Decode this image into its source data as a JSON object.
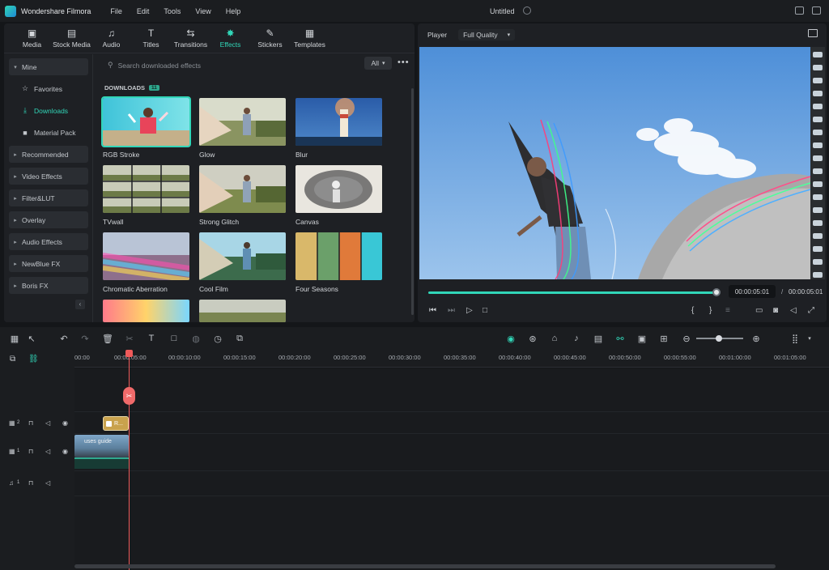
{
  "app": {
    "name": "Wondershare Filmora",
    "doc_title": "Untitled"
  },
  "menu": [
    "File",
    "Edit",
    "Tools",
    "View",
    "Help"
  ],
  "toolbar": [
    {
      "label": "Media",
      "icon": "media-icon"
    },
    {
      "label": "Stock Media",
      "icon": "stock-media-icon"
    },
    {
      "label": "Audio",
      "icon": "audio-icon"
    },
    {
      "label": "Titles",
      "icon": "titles-icon"
    },
    {
      "label": "Transitions",
      "icon": "transitions-icon"
    },
    {
      "label": "Effects",
      "icon": "effects-icon",
      "active": true
    },
    {
      "label": "Stickers",
      "icon": "stickers-icon"
    },
    {
      "label": "Templates",
      "icon": "templates-icon"
    }
  ],
  "sidebar": {
    "items": [
      {
        "label": "Mine",
        "type": "group",
        "expanded": true
      },
      {
        "label": "Favorites",
        "type": "sub",
        "icon": "star-icon"
      },
      {
        "label": "Downloads",
        "type": "sub",
        "icon": "download-icon",
        "active": true
      },
      {
        "label": "Material Pack",
        "type": "sub",
        "icon": "package-icon"
      },
      {
        "label": "Recommended",
        "type": "group"
      },
      {
        "label": "Video Effects",
        "type": "group"
      },
      {
        "label": "Filter&LUT",
        "type": "group"
      },
      {
        "label": "Overlay",
        "type": "group"
      },
      {
        "label": "Audio Effects",
        "type": "group"
      },
      {
        "label": "NewBlue FX",
        "type": "group"
      },
      {
        "label": "Boris FX",
        "type": "group"
      }
    ]
  },
  "search": {
    "placeholder": "Search downloaded effects",
    "filter": "All"
  },
  "downloads": {
    "title": "DOWNLOADS",
    "count": "11",
    "effects": [
      {
        "label": "RGB Stroke",
        "selected": true
      },
      {
        "label": "Glow"
      },
      {
        "label": "Blur"
      },
      {
        "label": "TVwall"
      },
      {
        "label": "Strong Glitch"
      },
      {
        "label": "Canvas"
      },
      {
        "label": "Chromatic Aberration"
      },
      {
        "label": "Cool Film"
      },
      {
        "label": "Four Seasons"
      }
    ]
  },
  "player": {
    "label": "Player",
    "quality": "Full Quality",
    "current_time": "00:00:05:01",
    "separator": "/",
    "total_time": "00:00:05:01",
    "progress": 1.0
  },
  "timeline": {
    "ticks": [
      "00:00",
      "00:00:05:00",
      "00:00:10:00",
      "00:00:15:00",
      "00:00:20:00",
      "00:00:25:00",
      "00:00:30:00",
      "00:00:35:00",
      "00:00:40:00",
      "00:00:45:00",
      "00:00:50:00",
      "00:00:55:00",
      "00:01:00:00",
      "00:01:05:00"
    ],
    "tracks": [
      {
        "number": "2"
      },
      {
        "number": "1"
      },
      {
        "number": "1"
      }
    ],
    "effect_clip_label": "R...",
    "video_clip_label": "uses guide"
  },
  "colors": {
    "accent": "#31d6b8",
    "playhead": "#ef5a5a",
    "effect_clip": "#c9a24d"
  }
}
